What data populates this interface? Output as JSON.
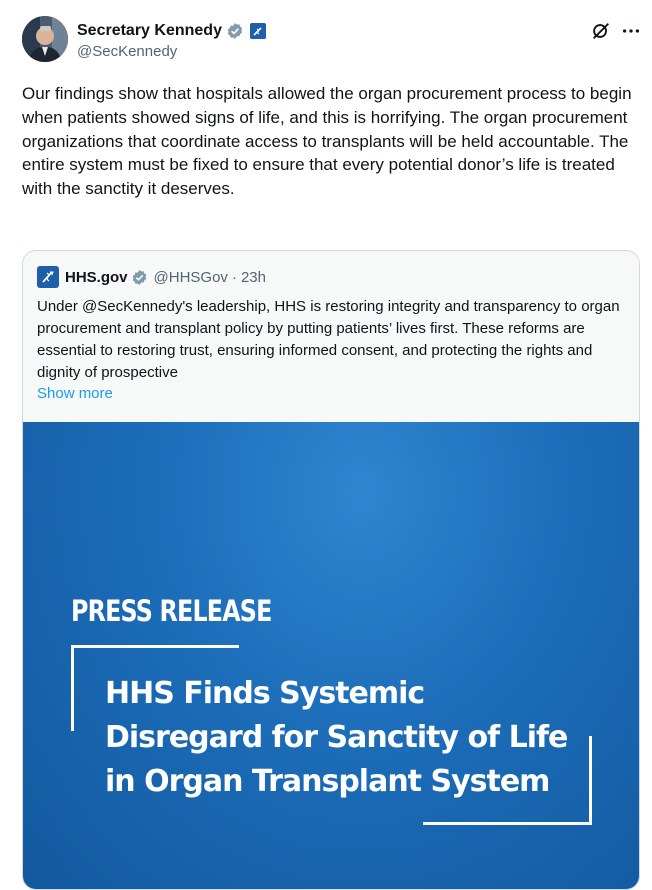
{
  "author": {
    "name": "Secretary Kennedy",
    "handle": "@SecKennedy",
    "verified_color": "#829aab",
    "gov_badge_color": "#1d5fa8"
  },
  "actions": {
    "grok_icon": "grok-icon",
    "more_icon": "more-icon"
  },
  "tweet": {
    "text": "Our findings show that hospitals allowed the organ procurement process to begin when patients showed signs of life, and this is horrifying. The organ procurement organizations that coordinate access to transplants will be held accountable. The entire system must be fixed to ensure that every potential donor’s life is treated with the sanctity it deserves."
  },
  "quote": {
    "name": "HHS.gov",
    "handle": "@HHSGov",
    "separator": "·",
    "time": "23h",
    "text": "Under @SecKennedy's leadership, HHS is restoring integrity and transparency to organ procurement and transplant policy by putting patients’ lives first. These reforms are essential to restoring trust, ensuring informed consent, and protecting the rights and dignity of prospective",
    "show_more": "Show more",
    "media": {
      "label": "PRESS RELEASE",
      "headline_line1": "HHS Finds Systemic",
      "headline_line2": "Disregard for Sanctity of Life",
      "headline_line3": "in Organ Transplant System",
      "background_color": "#1c6cb8"
    }
  },
  "colors": {
    "link": "#1d9bf0",
    "secondary_text": "#536471",
    "border": "#cfd9de"
  }
}
